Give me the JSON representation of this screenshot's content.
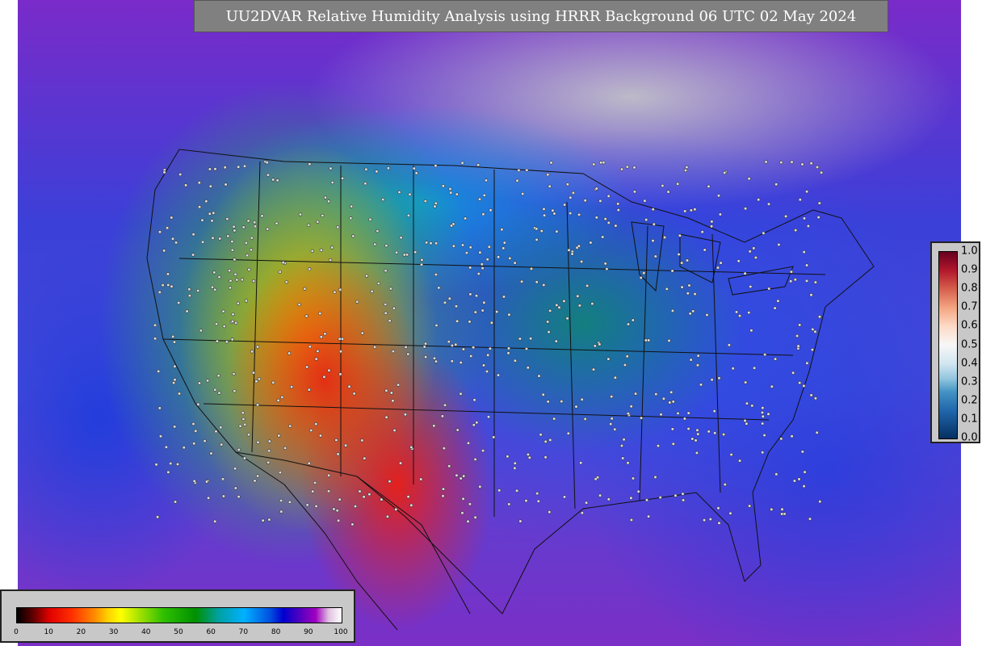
{
  "title": "UU2DVAR Relative Humidity Analysis using HRRR Background 06 UTC 02 May 2024",
  "humidity_legend": {
    "ticks": [
      "0",
      "10",
      "20",
      "30",
      "40",
      "50",
      "60",
      "70",
      "80",
      "90",
      "100"
    ]
  },
  "station_legend": {
    "ticks": [
      "1.0",
      "0.9",
      "0.8",
      "0.7",
      "0.6",
      "0.5",
      "0.4",
      "0.3",
      "0.2",
      "0.1",
      "0.0"
    ]
  },
  "colors": {
    "title_background": "#808080",
    "title_text": "#ffffff",
    "legend_background": "#c8c8c8"
  }
}
